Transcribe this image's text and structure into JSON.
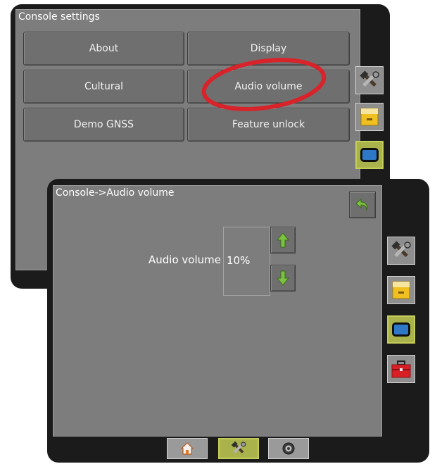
{
  "back_window": {
    "title": "Console settings",
    "buttons": [
      {
        "label": "About"
      },
      {
        "label": "Display"
      },
      {
        "label": "Cultural"
      },
      {
        "label": "Audio volume"
      },
      {
        "label": "Demo GNSS"
      },
      {
        "label": "Feature unlock"
      }
    ]
  },
  "front_window": {
    "title": "Console->Audio volume",
    "audio_volume_label": "Audio volume",
    "audio_volume_value": "10%"
  },
  "side_tabs": [
    {
      "icon": "tools-icon",
      "active": false
    },
    {
      "icon": "filing-cabinet-icon",
      "active": false
    },
    {
      "icon": "display-icon",
      "active": true
    },
    {
      "icon": "toolbox-icon",
      "active": false
    }
  ],
  "bottom_tabs": [
    {
      "icon": "home-icon",
      "active": false
    },
    {
      "icon": "tools-icon",
      "active": true
    },
    {
      "icon": "camera-icon",
      "active": false
    }
  ],
  "colors": {
    "highlight_ellipse": "#d8232a",
    "active_tab": "#aab34b",
    "arrow_green": "#7bc142",
    "content_bg": "#7d7d7d"
  }
}
